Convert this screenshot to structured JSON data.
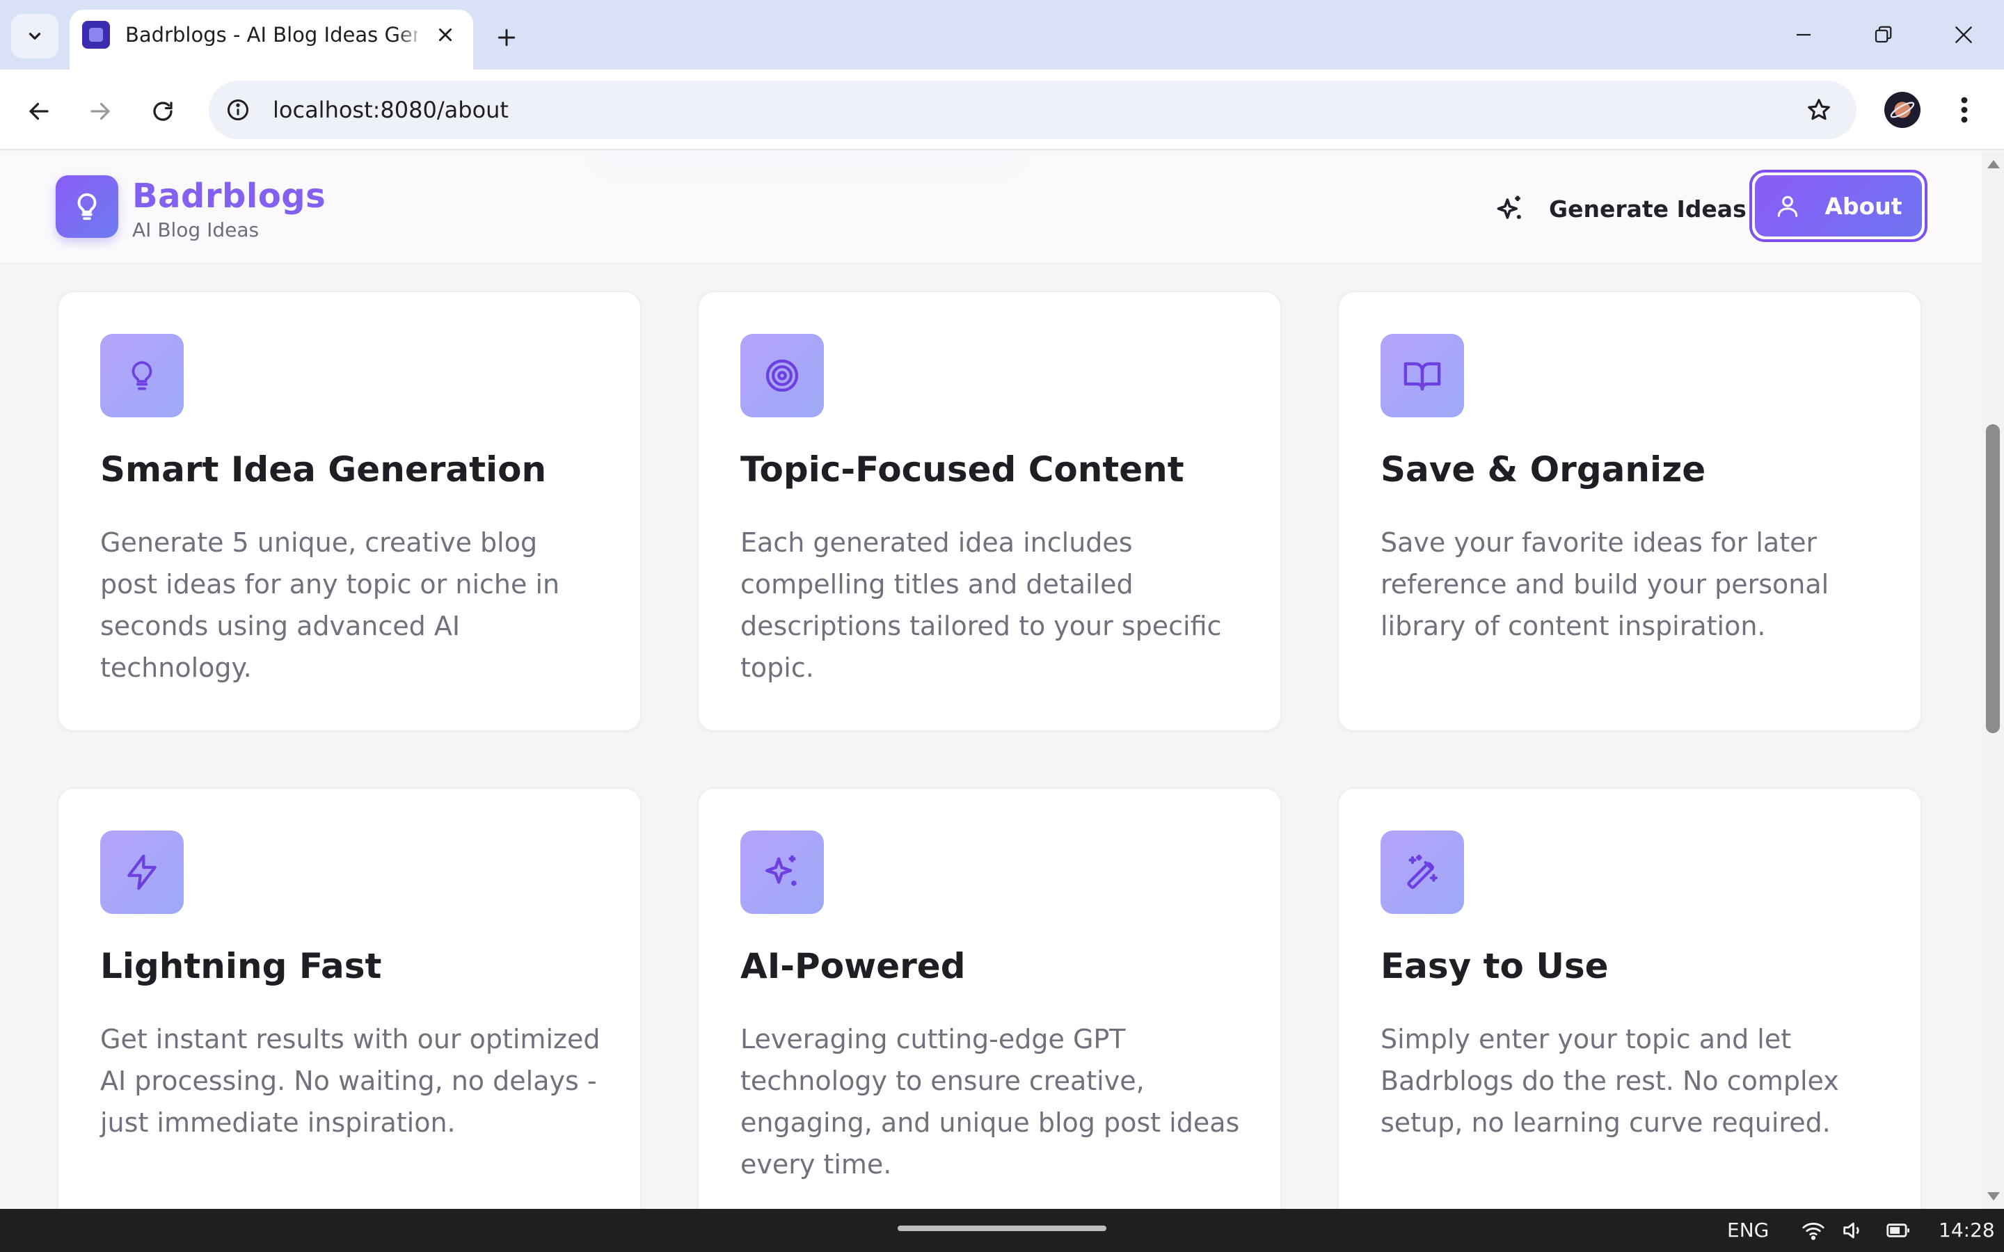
{
  "browser": {
    "tab_title": "Badrblogs - AI Blog Ideas Generator",
    "url": "localhost:8080/about"
  },
  "site": {
    "brand_name": "Badrblogs",
    "brand_tagline": "AI Blog Ideas",
    "nav": {
      "generate_label": "Generate Ideas",
      "about_label": "About"
    }
  },
  "features": [
    {
      "icon": "lightbulb-icon",
      "title": "Smart Idea Generation",
      "description": "Generate 5 unique, creative blog post ideas for any topic or niche in seconds using advanced AI technology."
    },
    {
      "icon": "target-icon",
      "title": "Topic-Focused Content",
      "description": "Each generated idea includes compelling titles and detailed descriptions tailored to your specific topic."
    },
    {
      "icon": "book-open-icon",
      "title": "Save & Organize",
      "description": "Save your favorite ideas for later reference and build your personal library of content inspiration."
    },
    {
      "icon": "lightning-icon",
      "title": "Lightning Fast",
      "description": "Get instant results with our optimized AI processing. No waiting, no delays - just immediate inspiration."
    },
    {
      "icon": "sparkles-icon",
      "title": "AI-Powered",
      "description": "Leveraging cutting-edge GPT technology to ensure creative, engaging, and unique blog post ideas every time."
    },
    {
      "icon": "magic-wand-icon",
      "title": "Easy to Use",
      "description": "Simply enter your topic and let Badrblogs do the rest. No complex setup, no learning curve required."
    }
  ],
  "taskbar": {
    "language": "ENG",
    "time": "14:28"
  },
  "colors": {
    "brand_primary": "#8b5cf6",
    "brand_secondary": "#6f74f2",
    "icon_tile": "#b4a3fb",
    "icon_stroke": "#6d3fe0"
  }
}
